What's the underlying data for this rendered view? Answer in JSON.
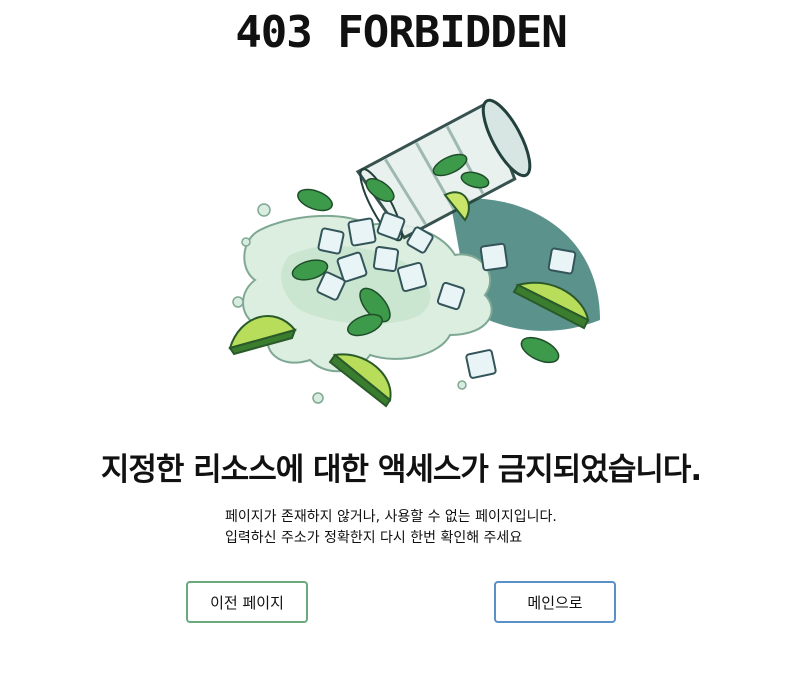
{
  "page": {
    "title": "403 FORBIDDEN",
    "headline": "지정한 리소스에 대한 액세스가 금지되었습니다.",
    "description": [
      "페이지가 존재하지 않거나, 사용할 수 없는 페이지입니다.",
      "입력하신 주소가 정확한지 다시 한번 확인해 주세요"
    ]
  },
  "illustration": {
    "icon": "spilled-mojito-glass-illustration"
  },
  "buttons": {
    "prev_label": "이전 페이지",
    "main_label": "메인으로"
  },
  "colors": {
    "prev_border": "#6aaa7a",
    "main_border": "#5b8fc8"
  }
}
